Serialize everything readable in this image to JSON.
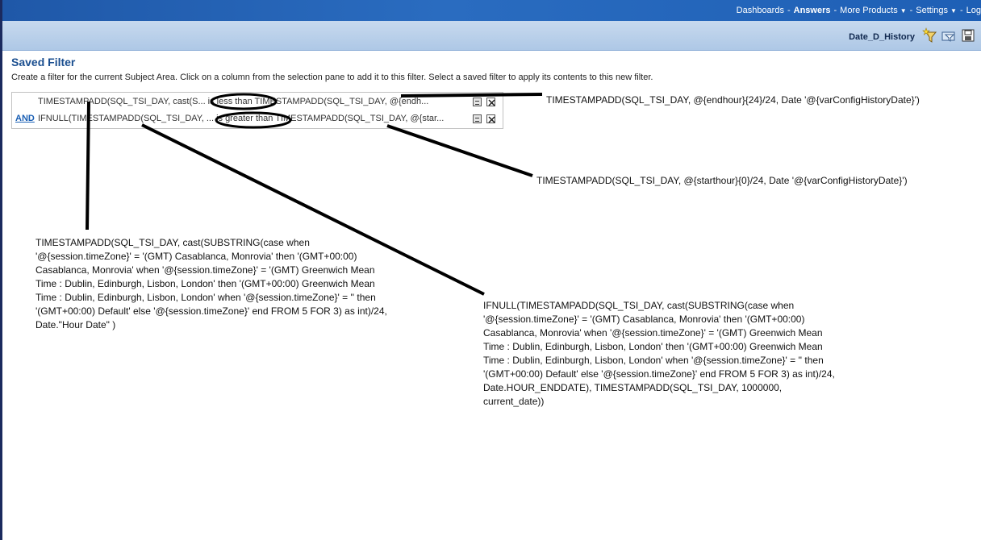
{
  "topnav": {
    "dashboards": "Dashboards",
    "separator": "-",
    "answers": "Answers",
    "more_products": "More Products",
    "settings": "Settings",
    "logout": "Log"
  },
  "subbar": {
    "document_title": "Date_D_History"
  },
  "page": {
    "title": "Saved Filter",
    "description": "Create a filter for the current Subject Area. Click on a column from the selection pane to add it to this filter. Select a saved filter to apply its contents to this new filter."
  },
  "filters": [
    {
      "operator": "",
      "text": "TIMESTAMPADD(SQL_TSI_DAY, cast(S... is less than TIMESTAMPADD(SQL_TSI_DAY, @{endh..."
    },
    {
      "operator": "AND",
      "text": "IFNULL(TIMESTAMPADD(SQL_TSI_DAY, ... is greater than TIMESTAMPADD(SQL_TSI_DAY, @{star..."
    }
  ],
  "annotations": {
    "end_note": "TIMESTAMPADD(SQL_TSI_DAY, @{endhour}{24}/24, Date '@{varConfigHistoryDate}')",
    "start_note": "TIMESTAMPADD(SQL_TSI_DAY, @{starthour}{0}/24, Date '@{varConfigHistoryDate}')",
    "left_note": "TIMESTAMPADD(SQL_TSI_DAY, cast(SUBSTRING(case when '@{session.timeZone}' = '(GMT) Casablanca, Monrovia' then '(GMT+00:00) Casablanca, Monrovia' when '@{session.timeZone}' = '(GMT) Greenwich Mean Time : Dublin, Edinburgh, Lisbon, London' then '(GMT+00:00) Greenwich Mean Time : Dublin, Edinburgh, Lisbon, London' when '@{session.timeZone}' = '' then '(GMT+00:00) Default' else '@{session.timeZone}' end FROM 5 FOR 3) as int)/24, Date.\"Hour Date\" )",
    "right_note": "IFNULL(TIMESTAMPADD(SQL_TSI_DAY,  cast(SUBSTRING(case when '@{session.timeZone}' = '(GMT) Casablanca, Monrovia' then '(GMT+00:00) Casablanca, Monrovia' when '@{session.timeZone}' = '(GMT) Greenwich Mean Time : Dublin, Edinburgh, Lisbon, London' then '(GMT+00:00) Greenwich Mean Time : Dublin, Edinburgh, Lisbon, London' when '@{session.timeZone}' = '' then '(GMT+00:00) Default' else '@{session.timeZone}' end FROM 5 FOR 3) as int)/24, Date.HOUR_ENDDATE), TIMESTAMPADD(SQL_TSI_DAY, 1000000, current_date))"
  },
  "colors": {
    "topbar": "#1f58a8",
    "subbar": "#aec8e6",
    "title": "#1a4e8f",
    "link": "#1a5fb4"
  }
}
